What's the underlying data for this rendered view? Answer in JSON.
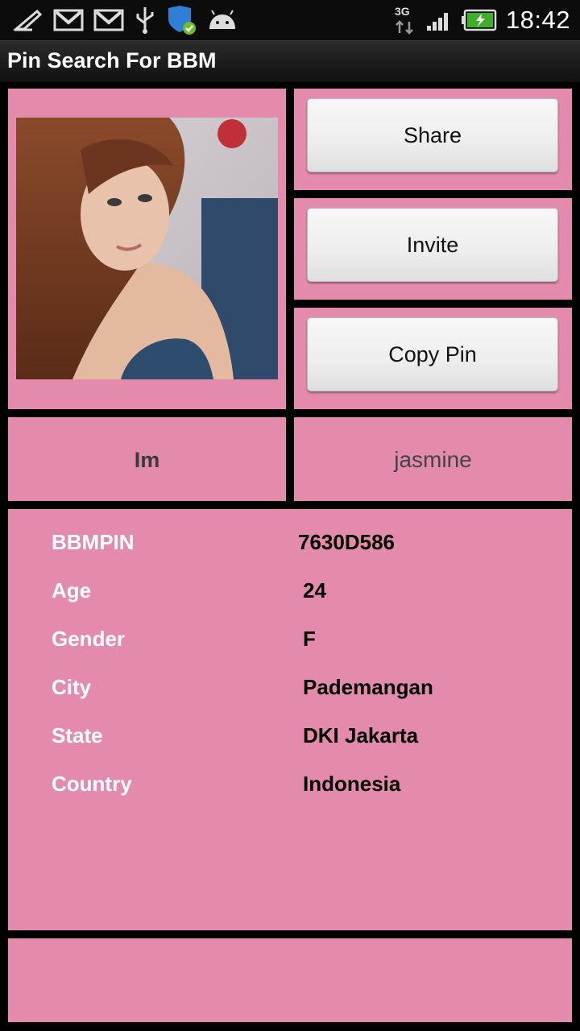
{
  "status_bar": {
    "time": "18:42",
    "network": "3G",
    "icons": [
      "feather-icon",
      "gmail-icon",
      "gmail-icon",
      "usb-icon",
      "shield-icon",
      "android-icon",
      "signal-icon",
      "battery-charging-icon"
    ]
  },
  "app": {
    "title": "Pin Search For BBM"
  },
  "actions": {
    "share": "Share",
    "invite": "Invite",
    "copy_pin": "Copy Pin"
  },
  "greeting": {
    "prefix": "Im",
    "name": "jasmine"
  },
  "details": [
    {
      "label": "BBMPIN",
      "value": "7630D586"
    },
    {
      "label": "Age",
      "value": "24"
    },
    {
      "label": "Gender",
      "value": "F"
    },
    {
      "label": "City",
      "value": "Pademangan"
    },
    {
      "label": "State",
      "value": "DKI Jakarta"
    },
    {
      "label": "Country",
      "value": "Indonesia"
    }
  ],
  "colors": {
    "panel": "#e48aac",
    "background": "#000000"
  }
}
